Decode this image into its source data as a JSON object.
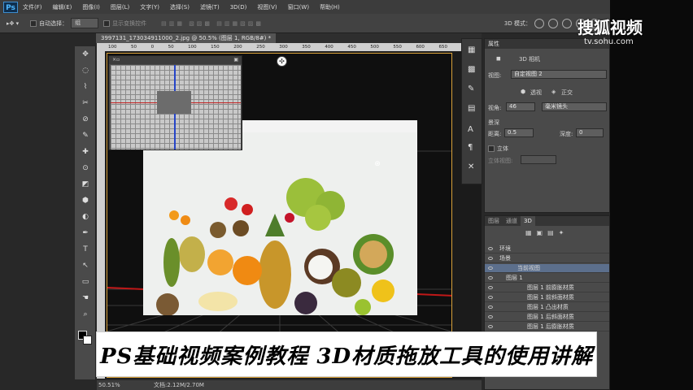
{
  "app": {
    "logo": "Ps"
  },
  "menu": [
    "文件(F)",
    "编辑(E)",
    "图像(I)",
    "图层(L)",
    "文字(Y)",
    "选择(S)",
    "滤镜(T)",
    "3D(D)",
    "视图(V)",
    "窗口(W)",
    "帮助(H)"
  ],
  "options": {
    "auto_select_label": "自动选择：",
    "auto_select_value": "组",
    "transform_label": "显示变换控件",
    "mode3d_label": "3D 模式："
  },
  "document": {
    "tab_title": "3997131_173034911000_2.jpg @ 50.5% (图层 1, RGB/8#) *",
    "zoom": "50.51%",
    "doc_info": "文档:2.12M/2.70M"
  },
  "ruler_ticks": [
    "100",
    "50",
    "0",
    "50",
    "100",
    "150",
    "200",
    "250",
    "300",
    "350",
    "400",
    "450",
    "500",
    "550",
    "600",
    "650",
    "700"
  ],
  "properties": {
    "title": "属性",
    "camera_label": "3D 相机",
    "view_label": "视图:",
    "view_value": "自定视图 2",
    "perspective_label": "透视",
    "ortho_label": "正交",
    "fov_label": "视角:",
    "fov_value": "46",
    "fov_unit": "毫米镜头",
    "dof_label": "景深",
    "distance_label": "距离:",
    "distance_value": "0.5",
    "depth_label": "深度:",
    "depth_value": "0",
    "stereo_label": "立体",
    "stereo_view_label": "立体视图:"
  },
  "panel3d": {
    "tabs": [
      "图层",
      "通道",
      "3D"
    ],
    "items": [
      {
        "label": "环境",
        "indent": 0,
        "selected": false
      },
      {
        "label": "场景",
        "indent": 0,
        "selected": false
      },
      {
        "label": "当前视图",
        "indent": 1,
        "selected": true
      },
      {
        "label": "图层 1",
        "indent": 1,
        "selected": false
      },
      {
        "label": "图层 1 前膨胀材质",
        "indent": 2,
        "selected": false
      },
      {
        "label": "图层 1 前斜面材质",
        "indent": 2,
        "selected": false
      },
      {
        "label": "图层 1 凸出材质",
        "indent": 2,
        "selected": false
      },
      {
        "label": "图层 1 后斜面材质",
        "indent": 2,
        "selected": false
      },
      {
        "label": "图层 1 后膨胀材质",
        "indent": 2,
        "selected": false
      }
    ]
  },
  "caption": "PS基础视频案例教程  3D材质拖放工具的使用讲解",
  "watermark": {
    "logo": "搜狐视频",
    "url": "tv.sohu.com"
  },
  "tools": [
    "✥",
    "◌",
    "⌇",
    "✂",
    "⊘",
    "✎",
    "✚",
    "⊙",
    "◩",
    "⬢",
    "◐",
    "✒",
    "T",
    "↖",
    "▭",
    "☚",
    "⌕"
  ]
}
